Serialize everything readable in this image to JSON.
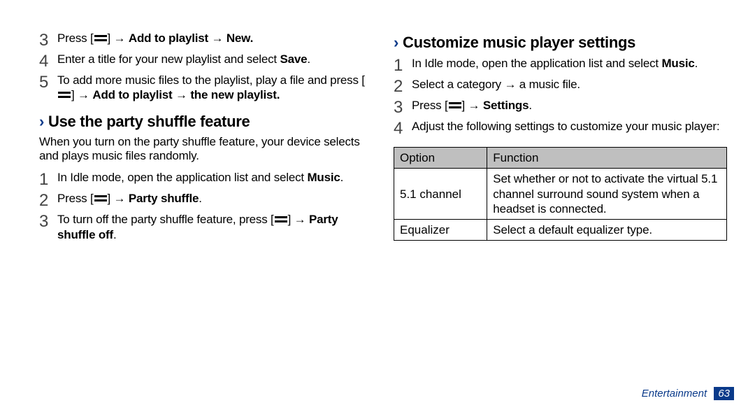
{
  "left": {
    "steps_top": [
      {
        "n": "3",
        "pre": "Press [",
        "post": "] → ",
        "rest": "Add to playlist → New.",
        "rest2": ""
      },
      {
        "n": "4",
        "pre": "",
        "post": "",
        "rest": "Enter a title for your new playlist and select ",
        "rest_bold": "Save",
        "rest_tail": "."
      },
      {
        "n": "5",
        "pre": "To add more music files to the playlist, play a file and press [",
        "post": "] → ",
        "rest": "Add to playlist → the new playlist."
      }
    ],
    "heading": "Use the party shuffle feature",
    "intro": "When you turn on the party shuffle feature, your device selects and plays music files randomly.",
    "steps_bottom": [
      {
        "n": "1",
        "text": "In Idle mode, open the application list and select ",
        "bold": "Music",
        "tail": "."
      },
      {
        "n": "2",
        "pre": "Press [",
        "post": "] → ",
        "bold": "Party shuffle",
        "tail": "."
      },
      {
        "n": "3",
        "pre": "To turn off the party shuffle feature, press [",
        "post": "] → ",
        "bold": "Party shuffle off",
        "tail": "."
      }
    ]
  },
  "right": {
    "heading": "Customize music player settings",
    "steps": [
      {
        "n": "1",
        "text": "In Idle mode, open the application list and select ",
        "bold": "Music",
        "tail": "."
      },
      {
        "n": "2",
        "text": "Select a category → a music file."
      },
      {
        "n": "3",
        "pre": "Press [",
        "post": "] → ",
        "bold": "Settings",
        "tail": "."
      },
      {
        "n": "4",
        "text": "Adjust the following settings to customize your music player:"
      }
    ],
    "table": {
      "headers": {
        "opt": "Option",
        "fn": "Function"
      },
      "rows": [
        {
          "opt": "5.1 channel",
          "fn": "Set whether or not to activate the virtual 5.1 channel surround sound system when a headset is connected."
        },
        {
          "opt": "Equalizer",
          "fn": "Select a default equalizer type."
        }
      ]
    }
  },
  "footer": {
    "label": "Entertainment",
    "page": "63"
  }
}
